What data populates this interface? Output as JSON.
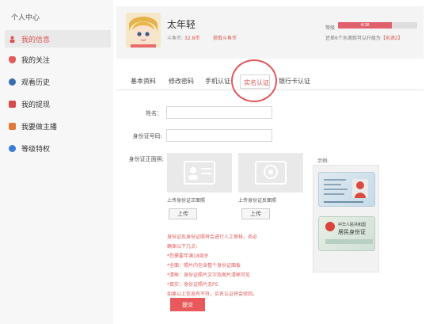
{
  "sidebar": {
    "title": "个人中心",
    "items": [
      {
        "label": "我的信息",
        "icon": "user-icon",
        "active": true
      },
      {
        "label": "我的关注",
        "icon": "heart-icon",
        "active": false
      },
      {
        "label": "观看历史",
        "icon": "clock-icon",
        "active": false
      },
      {
        "label": "我的提现",
        "icon": "withdraw-icon",
        "active": false
      },
      {
        "label": "我要做主播",
        "icon": "camera-icon",
        "active": false
      },
      {
        "label": "等级特权",
        "icon": "rank-icon",
        "active": false
      }
    ]
  },
  "profile": {
    "username": "太年轻",
    "coins_label": "斗鱼币:",
    "coins_value": "32.8币",
    "get_coins_link": "获取斗鱼币",
    "level_label": "等级",
    "level_progress_text": "4/38",
    "level_progress_fraction": 0.68,
    "level_note_prefix": "还差6个水滴就可以升级为",
    "level_note_highlight": "【水滴2】"
  },
  "tabs": [
    {
      "label": "基本资料",
      "active": false
    },
    {
      "label": "修改密码",
      "active": false
    },
    {
      "label": "手机认证",
      "active": false
    },
    {
      "label": "实名认证",
      "active": true
    },
    {
      "label": "银行卡认证",
      "active": false
    }
  ],
  "form": {
    "name_label": "姓名：",
    "name_value": "",
    "id_label": "身份证号码:",
    "id_value": "",
    "id_front_label": "身份证正面照:",
    "upload_front_caption": "上传身份证正面照",
    "upload_back_caption": "上传身份证反面照",
    "upload_button": "上传",
    "example_label": "示例:",
    "id_back_title": "中华人民共和国",
    "id_back_big": "居民身份证",
    "notes": [
      "身份证及身份证照将会进行人工审核，务必",
      "确保以下几点：",
      "*您需要年满18周岁",
      "*全面：照片内包含整个身份证面板",
      "*清晰：身份证照片文字及图片清晰可见",
      "*真实：身份证照片无PS",
      "如果以上信息有不符，实名认证将会驳回。"
    ],
    "submit_button": "提交"
  },
  "colors": {
    "accent": "#d9534f",
    "submit": "#e9595b",
    "highlight_circle": "#e2585a"
  }
}
